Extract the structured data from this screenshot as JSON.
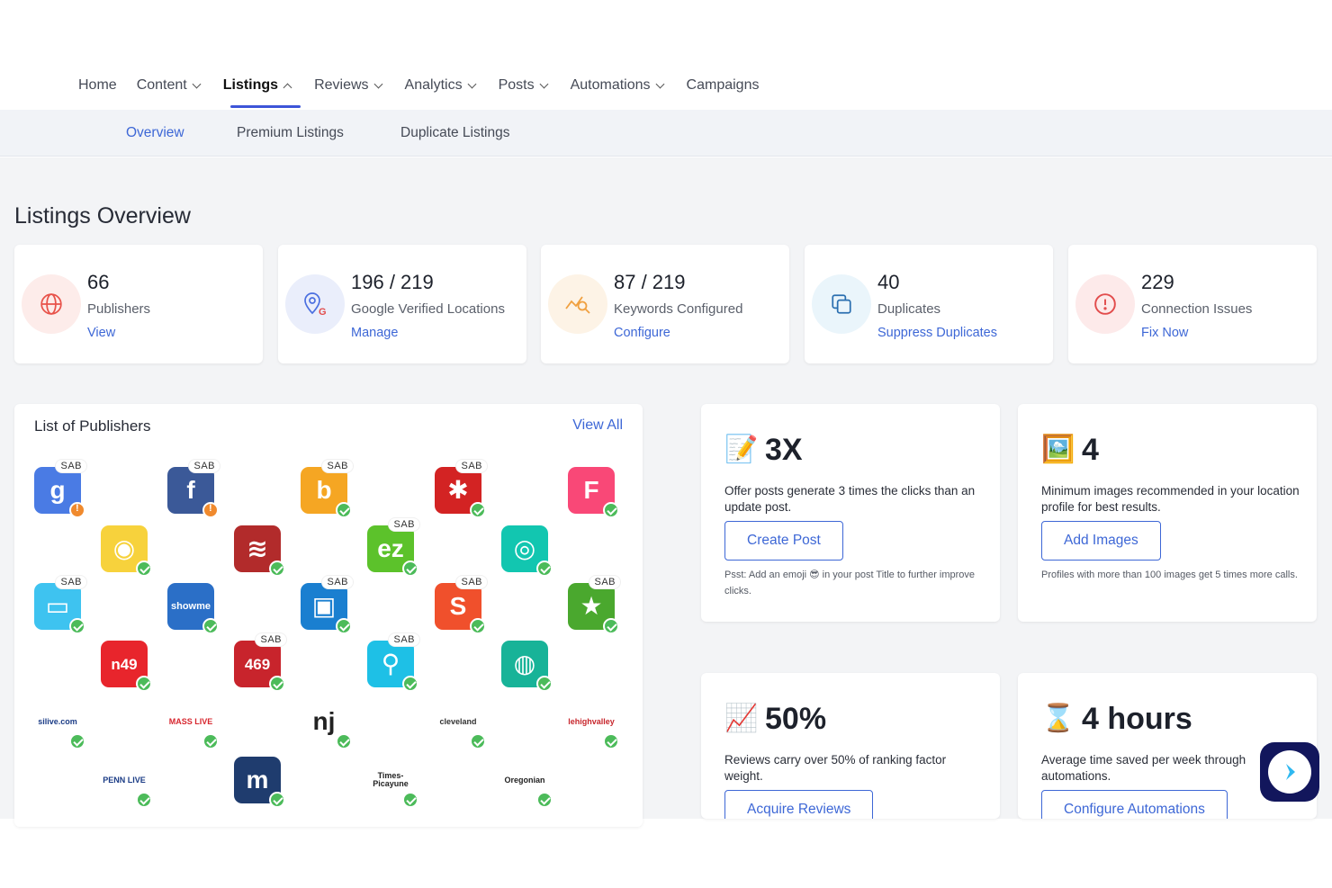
{
  "nav": {
    "items": [
      {
        "label": "Home",
        "dropdown": false,
        "active": false
      },
      {
        "label": "Content",
        "dropdown": true,
        "active": false
      },
      {
        "label": "Listings",
        "dropdown": true,
        "active": true
      },
      {
        "label": "Reviews",
        "dropdown": true,
        "active": false
      },
      {
        "label": "Analytics",
        "dropdown": true,
        "active": false
      },
      {
        "label": "Posts",
        "dropdown": true,
        "active": false
      },
      {
        "label": "Automations",
        "dropdown": true,
        "active": false
      },
      {
        "label": "Campaigns",
        "dropdown": false,
        "active": false
      }
    ]
  },
  "subnav": {
    "items": [
      {
        "label": "Overview",
        "active": true
      },
      {
        "label": "Premium Listings",
        "active": false
      },
      {
        "label": "Duplicate Listings",
        "active": false
      }
    ]
  },
  "page": {
    "title": "Listings Overview"
  },
  "stats": [
    {
      "value": "66",
      "label": "Publishers",
      "link": "View",
      "icon": "globe-icon",
      "color": "#e8524a"
    },
    {
      "value": "196 / 219",
      "label": "Google Verified Locations",
      "link": "Manage",
      "icon": "google-location-icon",
      "color": "#4b6fe0"
    },
    {
      "value": "87 / 219",
      "label": "Keywords Configured",
      "link": "Configure",
      "icon": "keyword-search-icon",
      "color": "#f0a040"
    },
    {
      "value": "40",
      "label": "Duplicates",
      "link": "Suppress Duplicates",
      "icon": "copy-icon",
      "color": "#4aa3d6"
    },
    {
      "value": "229",
      "label": "Connection Issues",
      "link": "Fix Now",
      "icon": "alert-icon",
      "color": "#e24c4c"
    }
  ],
  "publishers": {
    "title": "List of Publishers",
    "view_all": "View All",
    "sab_label": "SAB",
    "logos": [
      {
        "name": "google",
        "text": "g",
        "bg": "#4a7be4",
        "sab": true,
        "status": "warn"
      },
      {
        "name": "facebook",
        "text": "f",
        "bg": "#3b5998",
        "sab": true,
        "status": "warn"
      },
      {
        "name": "bing",
        "text": "b",
        "bg": "#f5a623",
        "sab": true,
        "status": "ok"
      },
      {
        "name": "yelp",
        "text": "✱",
        "bg": "#d32323",
        "sab": true,
        "status": "ok"
      },
      {
        "name": "foursquare",
        "text": "F",
        "bg": "#f94877",
        "sab": false,
        "status": "ok"
      },
      {
        "name": "parrot",
        "text": "◉",
        "bg": "#f7d23c",
        "sab": false,
        "status": "ok"
      },
      {
        "name": "mapquest",
        "text": "≋",
        "bg": "#b22b2b",
        "sab": false,
        "status": "ok"
      },
      {
        "name": "ezlocal",
        "text": "ez",
        "bg": "#5cc22b",
        "sab": true,
        "status": "ok"
      },
      {
        "name": "pin-teal",
        "text": "◎",
        "bg": "#12c6b0",
        "sab": false,
        "status": "ok"
      },
      {
        "name": "chat",
        "text": "▭",
        "bg": "#3ec3f0",
        "sab": true,
        "status": "ok"
      },
      {
        "name": "showmelocal",
        "text": "showme",
        "bg": "#2b6fc7",
        "sab": false,
        "status": "ok"
      },
      {
        "name": "bag",
        "text": "▣",
        "bg": "#1a7fd0",
        "sab": true,
        "status": "ok"
      },
      {
        "name": "superpages",
        "text": "S",
        "bg": "#f0502c",
        "sab": true,
        "status": "ok"
      },
      {
        "name": "star",
        "text": "★",
        "bg": "#4aa82e",
        "sab": true,
        "status": "ok"
      },
      {
        "name": "n49",
        "text": "n49",
        "bg": "#e8252c",
        "sab": false,
        "status": "ok"
      },
      {
        "name": "469",
        "text": "469",
        "bg": "#c8242c",
        "sab": true,
        "status": "ok"
      },
      {
        "name": "pin-cyan",
        "text": "⚲",
        "bg": "#1ec0e6",
        "sab": true,
        "status": "ok"
      },
      {
        "name": "pin-green",
        "text": "◍",
        "bg": "#18b398",
        "sab": false,
        "status": "ok"
      },
      {
        "name": "silive",
        "text": "silive.com",
        "bg": "#ffffff",
        "fg": "#1b3c86",
        "sab": false,
        "status": "ok"
      },
      {
        "name": "masslive",
        "text": "MASS LIVE",
        "bg": "#ffffff",
        "fg": "#d7262e",
        "sab": false,
        "status": "ok"
      },
      {
        "name": "nj",
        "text": "nj",
        "bg": "#ffffff",
        "fg": "#222222",
        "sab": false,
        "status": "ok"
      },
      {
        "name": "cleveland",
        "text": "cleveland",
        "bg": "#ffffff",
        "fg": "#333333",
        "sab": false,
        "status": "ok"
      },
      {
        "name": "lehighvalley",
        "text": "lehighvalley",
        "bg": "#ffffff",
        "fg": "#c7262c",
        "sab": false,
        "status": "ok"
      },
      {
        "name": "pennlive",
        "text": "PENN LIVE",
        "bg": "#ffffff",
        "fg": "#1b3c86",
        "sab": false,
        "status": "ok"
      },
      {
        "name": "mlive",
        "text": "m",
        "bg": "#1f3c6e",
        "sab": false,
        "status": "ok"
      },
      {
        "name": "times-picayune",
        "text": "Times-Picayune",
        "bg": "#ffffff",
        "fg": "#222222",
        "sab": false,
        "status": "ok"
      },
      {
        "name": "oregonlive",
        "text": "Oregonian",
        "bg": "#ffffff",
        "fg": "#222222",
        "sab": false,
        "status": "ok"
      }
    ]
  },
  "tips": [
    {
      "emoji": "📝",
      "icon": "memo-icon",
      "head": "3X",
      "text": "Offer posts generate 3 times the clicks than an update post.",
      "button": "Create Post",
      "foot": "Psst: Add an emoji 😎 in your post Title to further improve clicks."
    },
    {
      "emoji": "🖼️",
      "icon": "picture-icon",
      "head": "4",
      "text": "Minimum images recommended in your location profile for best results.",
      "button": "Add Images",
      "foot": "Profiles with more than 100 images get 5 times more calls."
    },
    {
      "emoji": "📈",
      "icon": "chart-up-icon",
      "head": "50%",
      "text": "Reviews carry over 50% of ranking factor weight.",
      "button": "Acquire Reviews",
      "foot": ""
    },
    {
      "emoji": "⌛",
      "icon": "hourglass-icon",
      "head": "4 hours",
      "text": "Average time saved per week through automations.",
      "button": "Configure Automations",
      "foot": ""
    }
  ],
  "colors": {
    "accent": "#3d67d6",
    "active_underline": "#3d55d8",
    "ok_badge": "#4cbb5a",
    "warn_badge": "#f08a2e",
    "chat_bg": "#12165c"
  }
}
